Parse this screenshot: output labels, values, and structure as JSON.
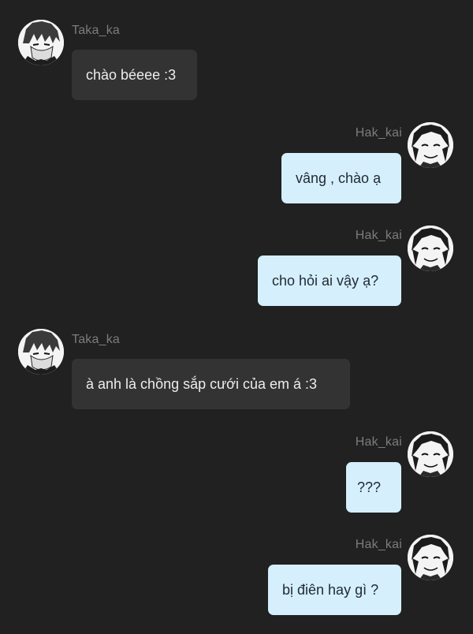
{
  "chat": {
    "messages": [
      {
        "sender": "Taka_ka",
        "direction": "incoming",
        "text": "chào béeee :3"
      },
      {
        "sender": "Hak_kai",
        "direction": "outgoing",
        "text": "vâng , chào ạ"
      },
      {
        "sender": "Hak_kai",
        "direction": "outgoing",
        "text": "cho hỏi ai vậy ạ?"
      },
      {
        "sender": "Taka_ka",
        "direction": "incoming",
        "text": "à anh là chồng sắp cưới của em á :3"
      },
      {
        "sender": "Hak_kai",
        "direction": "outgoing",
        "text": "???"
      },
      {
        "sender": "Hak_kai",
        "direction": "outgoing",
        "text": "bị điên hay gì ?"
      }
    ]
  },
  "colors": {
    "background": "#212121",
    "incoming_bubble": "#333333",
    "outgoing_bubble": "#d5effd",
    "sender_name": "#7c7c7c"
  },
  "icons": {
    "incoming_avatar": "manga-portrait-avatar",
    "outgoing_avatar": "manga-portrait-avatar"
  }
}
